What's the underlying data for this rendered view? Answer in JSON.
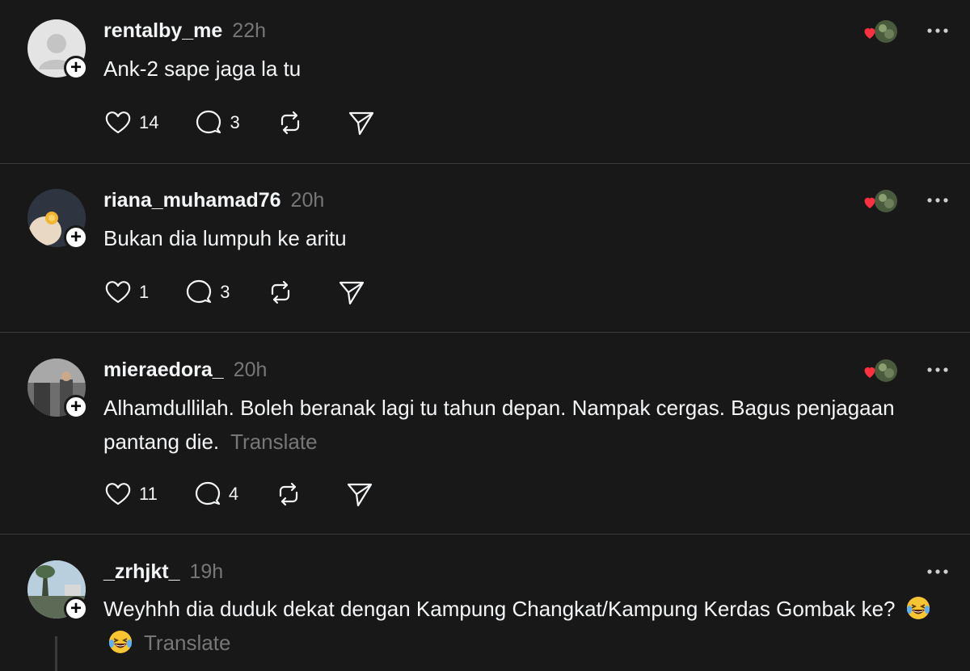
{
  "posts": [
    {
      "username": "rentalby_me",
      "time": "22h",
      "text": "Ank-2 sape jaga la tu",
      "translate": "",
      "likes": "14",
      "replies": "3",
      "liked_by_author": true
    },
    {
      "username": "riana_muhamad76",
      "time": "20h",
      "text": "Bukan dia lumpuh ke aritu",
      "translate": "",
      "likes": "1",
      "replies": "3",
      "liked_by_author": true
    },
    {
      "username": "mieraedora_",
      "time": "20h",
      "text": "Alhamdullilah. Boleh beranak lagi tu tahun depan. Nampak cergas. Bagus penjagaan pantang die.",
      "translate": "Translate",
      "likes": "11",
      "replies": "4",
      "liked_by_author": true
    },
    {
      "username": "_zrhjkt_",
      "time": "19h",
      "text": "Weyhhh dia duduk dekat dengan Kampung Changkat/Kampung Kerdas Gombak ke?",
      "translate": "Translate",
      "emojis": [
        "grinning-squinting-tears-emoji",
        "grinning-squinting-tears-emoji"
      ],
      "liked_by_author": false
    }
  ],
  "colors": {
    "background": "#181818",
    "text": "#f3f5f7",
    "muted": "#777777",
    "divider": "#3a3a3a",
    "heart": "#ff3040"
  }
}
